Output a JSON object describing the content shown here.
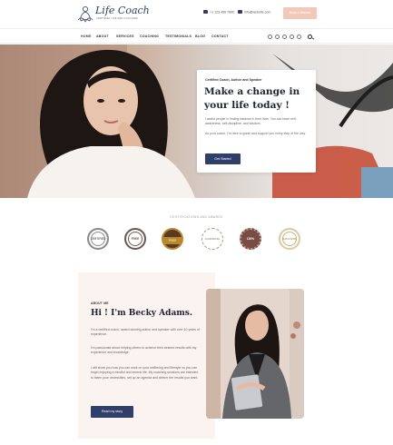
{
  "header": {
    "logo_text": "Life Coach",
    "logo_tagline": "CERTIFIED LIFE AND COACHING",
    "phone": "+1 123 456 7890",
    "email": "info@website.com",
    "cta_label": "Book a Session"
  },
  "nav": {
    "items": [
      "HOME",
      "ABOUT",
      "SERVICES",
      "COACHING",
      "TESTIMONIALS",
      "BLOG",
      "CONTACT"
    ],
    "social_icons": [
      "facebook-icon",
      "instagram-icon",
      "twitter-icon",
      "linkedin-icon",
      "youtube-icon"
    ]
  },
  "hero": {
    "kicker": "Certified Coach, Author and Speaker",
    "title": "Make a change in your life today !",
    "paragraph_1": "I assist people in finding balance in their lives. You can learn self-awareness, self-discipline, and wisdom.",
    "paragraph_2": "As your coach, I'm here to guide and support you every step of the way.",
    "button_label": "Get Started"
  },
  "certifications": {
    "heading": "CERTIFICATIONS AND AWARDS",
    "badges": [
      {
        "label": "CERTIFIED",
        "color": "#6e6e6e"
      },
      {
        "label": "FREE",
        "color": "#6b5a52"
      },
      {
        "label": "FREE",
        "color": "#b8892c"
      },
      {
        "label": "GUARANTEE",
        "color": "#9c9c88"
      },
      {
        "label": "100%",
        "color": "#7a4d44"
      },
      {
        "label": "EXCLUSIVE",
        "color": "#c2b17e"
      }
    ]
  },
  "about": {
    "kicker": "ABOUT ME",
    "title": "Hi ! I'm Becky Adams.",
    "paragraph_1": "I'm a certified coach, award-winning author and speaker with over 10 years of experience.",
    "paragraph_2": "I'm passionate about helping others to achieve their desired results with my experience and knowledge.",
    "paragraph_3": "I will show you how you can work on your wellbeing and lifestyle so you can begin enjoying a mindful and serene life. My coaching sessions are intended to listen your necessities, set up an agenda and deliver the results you want.",
    "button_label": "Read my story"
  },
  "colors": {
    "brand": "#2f3f6a",
    "accent_peach": "#f4c8b8",
    "about_bg": "#fbf3ef"
  }
}
